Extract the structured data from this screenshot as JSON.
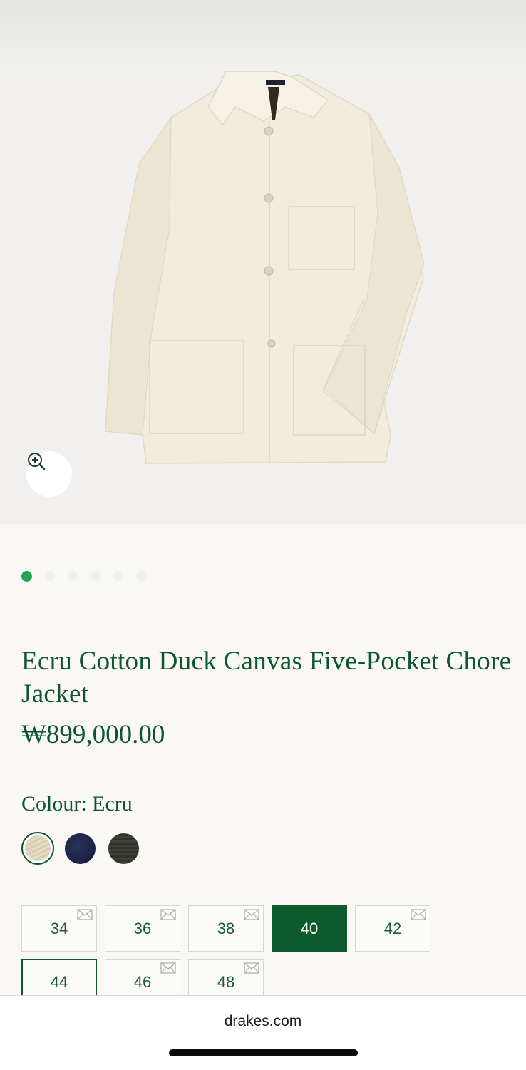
{
  "product": {
    "title": "Ecru Cotton Duck Canvas Five-Pocket Chore Jacket",
    "price": "₩899,000.00",
    "colour_label": "Colour: Ecru"
  },
  "gallery": {
    "slide_count": 6,
    "active_slide": 1
  },
  "colours": [
    {
      "name": "Ecru",
      "hex": "#e3d8c0",
      "selected": true
    },
    {
      "name": "Navy",
      "hex": "#1f2446",
      "selected": false
    },
    {
      "name": "Olive",
      "hex": "#383d31",
      "selected": false
    }
  ],
  "sizes": [
    {
      "label": "34",
      "notify_icon": "mail-icon"
    },
    {
      "label": "36",
      "notify_icon": "mail-icon"
    },
    {
      "label": "38",
      "notify_icon": "mail-icon"
    },
    {
      "label": "40",
      "selected": true
    },
    {
      "label": "42",
      "notify_icon": "mail-icon"
    },
    {
      "label": "44"
    },
    {
      "label": "46",
      "notify_icon": "mail-icon"
    },
    {
      "label": "48",
      "notify_icon": "mail-icon"
    }
  ],
  "browser": {
    "domain": "drakes.com"
  },
  "colors": {
    "brand_green": "#0f5532",
    "active_dot": "#1fa35a",
    "background": "#f9f8f4"
  }
}
